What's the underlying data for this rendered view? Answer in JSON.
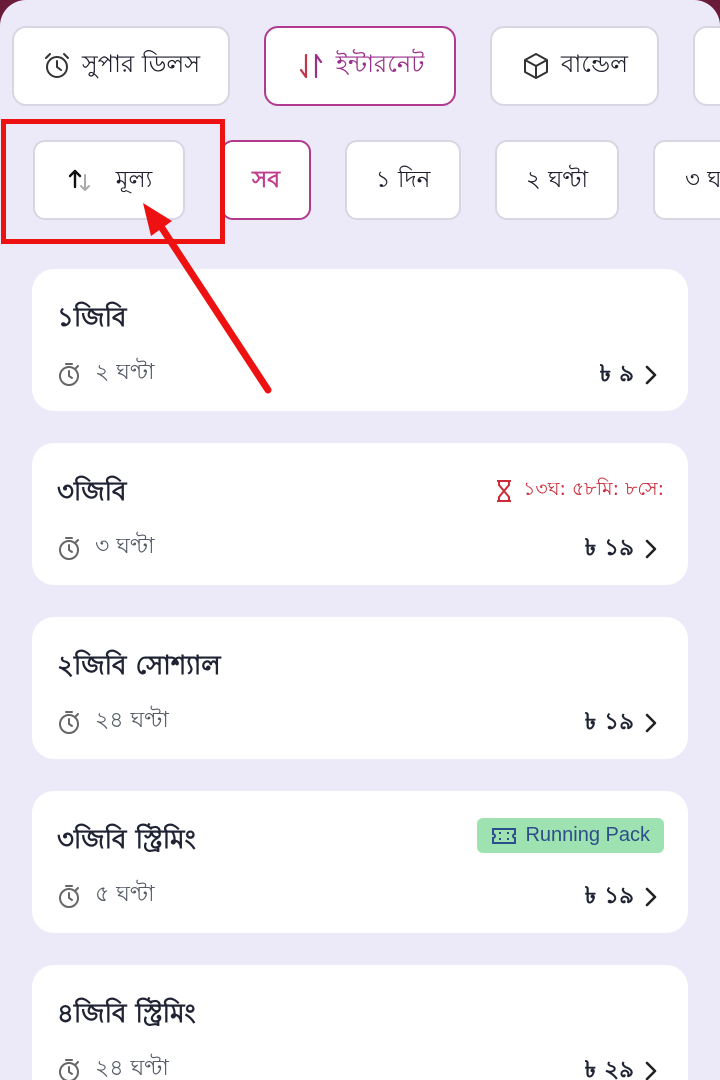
{
  "categories": [
    {
      "label": "সুপার ডিলস",
      "icon": "alarm-clock-icon",
      "active": false
    },
    {
      "label": "ইন্টারনেট",
      "icon": "data-transfer-icon",
      "active": true
    },
    {
      "label": "বান্ডেল",
      "icon": "box-icon",
      "active": false
    }
  ],
  "sort": {
    "label": "মূল্য",
    "icon": "sort-arrows-icon"
  },
  "filters": [
    {
      "label": "সব",
      "active": true
    },
    {
      "label": "১ দিন",
      "active": false
    },
    {
      "label": "২ ঘণ্টা",
      "active": false
    },
    {
      "label": "৩ ঘ",
      "active": false
    }
  ],
  "packs": [
    {
      "title": "১জিবি",
      "duration": "২ ঘণ্টা",
      "price": "৳ ৯"
    },
    {
      "title": "৩জিবি",
      "duration": "৩ ঘণ্টা",
      "price": "৳ ১৯",
      "timer": "১৩ঘ: ৫৮মি: ৮সে:"
    },
    {
      "title": "২জিবি সোশ্যাল",
      "duration": "২৪ ঘণ্টা",
      "price": "৳ ১৯"
    },
    {
      "title": "৩জিবি স্ট্রিমিং",
      "duration": "৫ ঘণ্টা",
      "price": "৳ ১৯",
      "badge": "Running Pack"
    },
    {
      "title": "৪জিবি স্ট্রিমিং",
      "duration": "২৪ ঘণ্টা",
      "price": "৳ ২৯"
    }
  ],
  "colors": {
    "accent": "#b03a8e",
    "annotation": "#ee1111",
    "timer": "#cc2b3a",
    "badge_bg": "#9fe2b1"
  }
}
